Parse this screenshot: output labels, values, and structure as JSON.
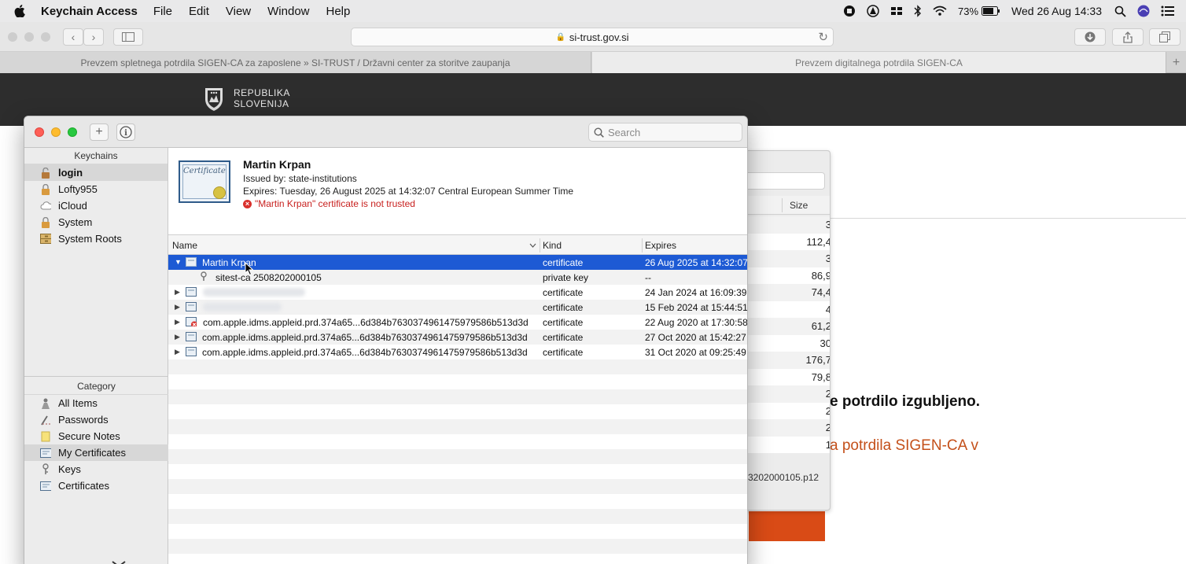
{
  "menubar": {
    "app_name": "Keychain Access",
    "menus": [
      "File",
      "Edit",
      "View",
      "Window",
      "Help"
    ],
    "battery": "73%",
    "datetime": "Wed 26 Aug  14:33"
  },
  "browser": {
    "url": "si-trust.gov.si",
    "tabs": [
      {
        "label": "Prevzem spletnega potrdila SIGEN-CA za zaposlene » SI-TRUST / Državni center za storitve zaupanja"
      },
      {
        "label": "Prevzem digitalnega potrdila SIGEN-CA"
      }
    ],
    "new_tab": "+"
  },
  "webpage": {
    "brand_line1": "REPUBLIKA",
    "brand_line2": "SLOVENIJA",
    "bold_text": "e potrdilo izgubljeno.",
    "orange_text": "a potrdila SIGEN-CA v"
  },
  "import_dialog": {
    "size_header": "Size",
    "sizes": [
      "3",
      "112,4",
      "3",
      "86,9",
      "74,4",
      "4",
      "61,2",
      "30",
      "176,7",
      "79,8",
      "2",
      "2",
      "2",
      "1"
    ],
    "filename": "3202000105.p12"
  },
  "keychain": {
    "search_placeholder": "Search",
    "add_button": "+",
    "info_button": "i",
    "keychains_header": "Keychains",
    "keychains": [
      {
        "label": "login",
        "icon": "lock-open-icon"
      },
      {
        "label": "Lofty955",
        "icon": "lock-icon"
      },
      {
        "label": "iCloud",
        "icon": "cloud-icon"
      },
      {
        "label": "System",
        "icon": "lock-icon"
      },
      {
        "label": "System Roots",
        "icon": "cabinet-icon"
      }
    ],
    "category_header": "Category",
    "categories": [
      {
        "label": "All Items",
        "icon": "all-items-icon"
      },
      {
        "label": "Passwords",
        "icon": "password-icon"
      },
      {
        "label": "Secure Notes",
        "icon": "note-icon"
      },
      {
        "label": "My Certificates",
        "icon": "certificate-icon"
      },
      {
        "label": "Keys",
        "icon": "key-icon"
      },
      {
        "label": "Certificates",
        "icon": "certificate-icon"
      }
    ],
    "detail": {
      "cert_badge": "Certificate",
      "name": "Martin Krpan",
      "issued_by": "Issued by: state-institutions",
      "expires": "Expires: Tuesday, 26 August 2025 at 14:32:07 Central European Summer Time",
      "warning": "\"Martin Krpan\" certificate is not trusted"
    },
    "columns": {
      "name": "Name",
      "kind": "Kind",
      "expires": "Expires"
    },
    "rows": [
      {
        "name": "Martin Krpan",
        "kind": "certificate",
        "expires": "26 Aug 2025 at 14:32:07"
      },
      {
        "name": "sitest-ca 2508202000105",
        "kind": "private key",
        "expires": "--"
      },
      {
        "name": "",
        "kind": "certificate",
        "expires": "24 Jan 2024 at 16:09:39"
      },
      {
        "name": "",
        "kind": "certificate",
        "expires": "15 Feb 2024 at 15:44:51"
      },
      {
        "name": "com.apple.idms.appleid.prd.374a65...6d384b7630374961475979586b513d3d",
        "kind": "certificate",
        "expires": "22 Aug 2020 at 17:30:58"
      },
      {
        "name": "com.apple.idms.appleid.prd.374a65...6d384b7630374961475979586b513d3d",
        "kind": "certificate",
        "expires": "27 Oct 2020 at 15:42:27"
      },
      {
        "name": "com.apple.idms.appleid.prd.374a65...6d384b7630374961475979586b513d3d",
        "kind": "certificate",
        "expires": "31 Oct 2020 at 09:25:49"
      }
    ]
  }
}
